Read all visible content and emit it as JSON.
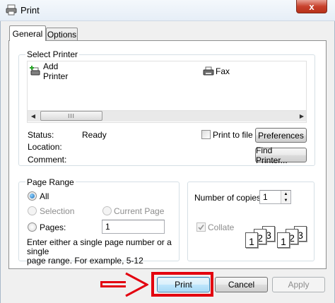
{
  "window": {
    "title": "Print",
    "close_glyph": "x"
  },
  "tabs": {
    "general": "General",
    "options": "Options"
  },
  "select_printer": {
    "label": "Select Printer",
    "printers": [
      {
        "name": "Add Printer",
        "icon": "add-printer-icon"
      },
      {
        "name": "Fax",
        "icon": "fax-printer-icon"
      }
    ],
    "scroll_thumb_grip": "III"
  },
  "status": {
    "status_label": "Status:",
    "status_value": "Ready",
    "location_label": "Location:",
    "comment_label": "Comment:",
    "print_to_file": "Print to file",
    "preferences_button": "Preferences",
    "find_printer_button": "Find Printer..."
  },
  "page_range": {
    "label": "Page Range",
    "all": "All",
    "selection": "Selection",
    "current_page": "Current Page",
    "pages": "Pages:",
    "pages_value": "1",
    "help_line1": "Enter either a single page number or a single",
    "help_line2": "page range.  For example, 5-12",
    "selected": "All"
  },
  "copies": {
    "label": "Number of copies:",
    "value": "1",
    "collate": "Collate",
    "collate_checked": true,
    "collate_enabled": false,
    "page_numbers": [
      "1",
      "2",
      "3"
    ]
  },
  "buttons": {
    "print": "Print",
    "cancel": "Cancel",
    "apply": "Apply"
  },
  "colors": {
    "annotation_red": "#e3000f",
    "default_button_border": "#3c7fb1"
  }
}
